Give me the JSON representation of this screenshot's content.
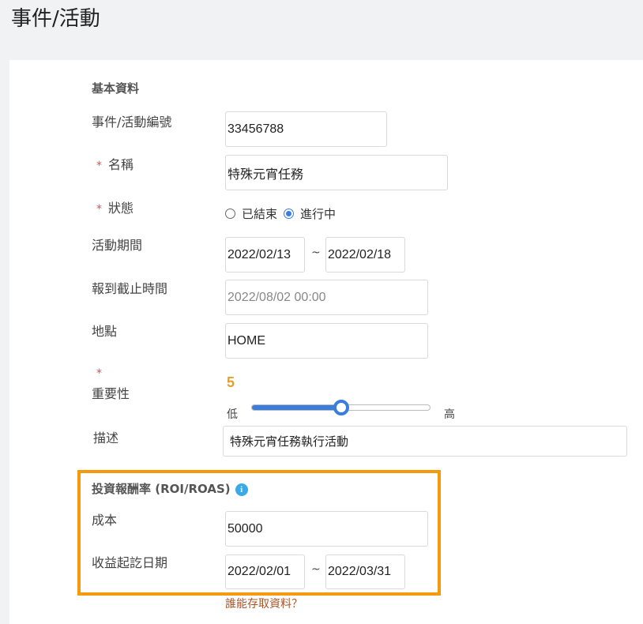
{
  "page": {
    "title": "事件/活動"
  },
  "basic": {
    "section_title": "基本資料",
    "event_id": {
      "label": "事件/活動編號",
      "value": "33456788"
    },
    "name": {
      "required_mark": "*",
      "label": "名稱",
      "value": "特殊元宵任務"
    },
    "status": {
      "required_mark": "*",
      "label": "狀態",
      "options": [
        {
          "label": "已結束",
          "checked": false
        },
        {
          "label": "進行中",
          "checked": true
        }
      ]
    },
    "period": {
      "label": "活動期間",
      "start": "2022/02/13",
      "separator": "~",
      "end": "2022/02/18"
    },
    "checkin_deadline": {
      "label": "報到截止時間",
      "placeholder": "2022/08/02 00:00"
    },
    "location": {
      "label": "地點",
      "value": "HOME"
    },
    "importance": {
      "required_mark": "*",
      "label": "重要性",
      "value": "5",
      "level_fraction": 0.5,
      "low_label": "低",
      "high_label": "高"
    },
    "description": {
      "label": "描述",
      "value": "特殊元宵任務執行活動"
    }
  },
  "roi": {
    "section_title": "投資報酬率 (ROI/ROAS)",
    "info_icon": "info-icon",
    "cost": {
      "label": "成本",
      "value": "50000"
    },
    "revenue_period": {
      "label": "收益起訖日期",
      "start": "2022/02/01",
      "separator": "~",
      "end": "2022/03/31"
    }
  },
  "access_link": "誰能存取資料？",
  "colors": {
    "accent": "#3b7ddd",
    "highlight": "#f59a0c",
    "importance": "#e0a030",
    "required": "#d9534f"
  }
}
